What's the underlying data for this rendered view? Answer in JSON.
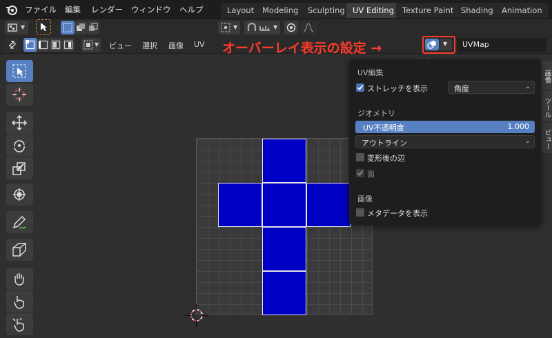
{
  "menu": {
    "items": [
      "ファイル",
      "編集",
      "レンダー",
      "ウィンドウ",
      "ヘルプ"
    ]
  },
  "workspace_tabs": [
    "Layout",
    "Modeling",
    "Sculpting",
    "UV Editing",
    "Texture Paint",
    "Shading",
    "Animation"
  ],
  "active_workspace": "UV Editing",
  "editor_menu": {
    "items": [
      "ビュー",
      "選択",
      "画像",
      "UV"
    ]
  },
  "annotation": {
    "text": "オーバーレイ表示の設定 →",
    "color": "#ff3b2a"
  },
  "uv_map": {
    "name": "UVMap"
  },
  "faded_panel_label": "UV編集",
  "overlay_popup": {
    "uv_section": {
      "title": "UV編集",
      "stretch_label": "ストレッチを表示",
      "stretch_checked": true,
      "stretch_mode": "角度"
    },
    "geometry_section": {
      "title": "ジオメトリ",
      "opacity_label": "UV不透明度",
      "opacity_value": "1.000",
      "edge_display": "アウトライン",
      "modified_edges_label": "変形後の辺",
      "modified_edges_checked": false,
      "faces_label": "面",
      "faces_checked": true
    },
    "image_section": {
      "title": "画像",
      "metadata_label": "メタデータを表示",
      "metadata_checked": false
    }
  },
  "sidebar_tabs": [
    "画像",
    "ツール",
    "ビュー"
  ],
  "colors": {
    "accent": "#5680c2",
    "uv_face": "#0000c4",
    "annotation": "#ff3b2a"
  }
}
